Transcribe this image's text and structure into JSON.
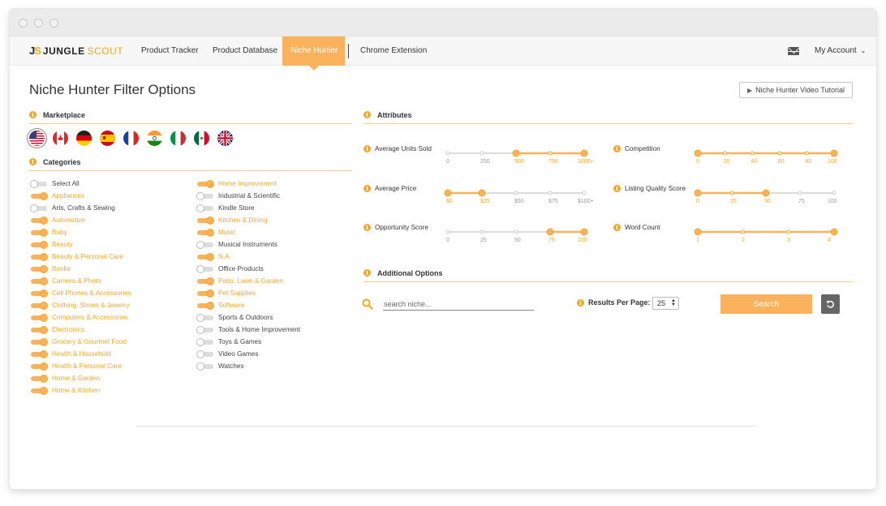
{
  "nav": {
    "logo_mark_a": "J",
    "logo_mark_b": "S",
    "logo_word1": "JUNGLE",
    "logo_word2": "SCOUT",
    "items": [
      {
        "label": "Product Tracker"
      },
      {
        "label": "Product Database"
      },
      {
        "label": "Niche Hunter",
        "active": true
      },
      {
        "label": "Chrome Extension"
      }
    ],
    "account_label": "My Account",
    "account_icon": "chevron-down-icon",
    "mail_icon": "envelope-icon"
  },
  "page": {
    "title": "Niche Hunter Filter Options",
    "tutorial_label": "Niche Hunter Video Tutorial",
    "tutorial_icon": "play-icon"
  },
  "colors": {
    "accent": "#fbb25c",
    "accent_dark": "#f5a623",
    "inactive": "#dcdcdc"
  },
  "marketplace": {
    "title": "Marketplace",
    "flags": [
      {
        "name": "us",
        "selected": true
      },
      {
        "name": "ca"
      },
      {
        "name": "de"
      },
      {
        "name": "es"
      },
      {
        "name": "fr"
      },
      {
        "name": "in"
      },
      {
        "name": "it"
      },
      {
        "name": "mx"
      },
      {
        "name": "uk"
      }
    ]
  },
  "categories": {
    "title": "Categories",
    "col1": [
      {
        "label": "Select All",
        "on": false
      },
      {
        "label": "Appliances",
        "on": true
      },
      {
        "label": "Arts, Crafts & Sewing",
        "on": false
      },
      {
        "label": "Automotive",
        "on": true
      },
      {
        "label": "Baby",
        "on": true
      },
      {
        "label": "Beauty",
        "on": true
      },
      {
        "label": "Beauty & Personal Care",
        "on": true
      },
      {
        "label": "Books",
        "on": true
      },
      {
        "label": "Camera & Photo",
        "on": true
      },
      {
        "label": "Cell Phones & Accessories",
        "on": true
      },
      {
        "label": "Clothing, Shoes & Jewelry",
        "on": true
      },
      {
        "label": "Computers & Accessories",
        "on": true
      },
      {
        "label": "Electronics",
        "on": true
      },
      {
        "label": "Grocery & Gourmet Food",
        "on": true
      },
      {
        "label": "Health & Household",
        "on": true
      },
      {
        "label": "Health & Personal Care",
        "on": true
      },
      {
        "label": "Home & Garden",
        "on": true
      },
      {
        "label": "Home & Kitchen",
        "on": true
      }
    ],
    "col2": [
      {
        "label": "Home Improvement",
        "on": true
      },
      {
        "label": "Industrial & Scientific",
        "on": false
      },
      {
        "label": "Kindle Store",
        "on": false
      },
      {
        "label": "Kitchen & Dining",
        "on": true
      },
      {
        "label": "Music",
        "on": true
      },
      {
        "label": "Musical Instruments",
        "on": false
      },
      {
        "label": "N.A.",
        "on": true
      },
      {
        "label": "Office Products",
        "on": false
      },
      {
        "label": "Patio, Lawn & Garden",
        "on": true
      },
      {
        "label": "Pet Supplies",
        "on": true
      },
      {
        "label": "Software",
        "on": true
      },
      {
        "label": "Sports & Outdoors",
        "on": false
      },
      {
        "label": "Tools & Home Improvement",
        "on": false
      },
      {
        "label": "Toys & Games",
        "on": false
      },
      {
        "label": "Video Games",
        "on": false
      },
      {
        "label": "Watches",
        "on": false
      }
    ]
  },
  "attributes": {
    "title": "Attributes",
    "sliders": [
      {
        "name": "Average Units Sold",
        "ticks": [
          "0",
          "250",
          "500",
          "750",
          "1000+"
        ],
        "range": [
          2,
          4
        ]
      },
      {
        "name": "Competition",
        "ticks": [
          "0",
          "20",
          "40",
          "60",
          "80",
          "100"
        ],
        "range": [
          0,
          5
        ]
      },
      {
        "name": "Average Price",
        "ticks": [
          "$0",
          "$25",
          "$50",
          "$75",
          "$100+"
        ],
        "range": [
          0,
          1
        ]
      },
      {
        "name": "Listing Quality Score",
        "ticks": [
          "0",
          "25",
          "50",
          "75",
          "100"
        ],
        "range": [
          0,
          2
        ]
      },
      {
        "name": "Opportunity Score",
        "ticks": [
          "0",
          "25",
          "50",
          "75",
          "100"
        ],
        "range": [
          3,
          4
        ]
      },
      {
        "name": "Word Count",
        "ticks": [
          "1",
          "2",
          "3",
          "4"
        ],
        "range": [
          0,
          3
        ]
      }
    ]
  },
  "additional": {
    "title": "Additional Options",
    "search_placeholder": "search niche...",
    "rpp_label": "Results Per Page:",
    "rpp_value": "25",
    "search_button": "Search",
    "reset_icon": "reset-icon"
  }
}
